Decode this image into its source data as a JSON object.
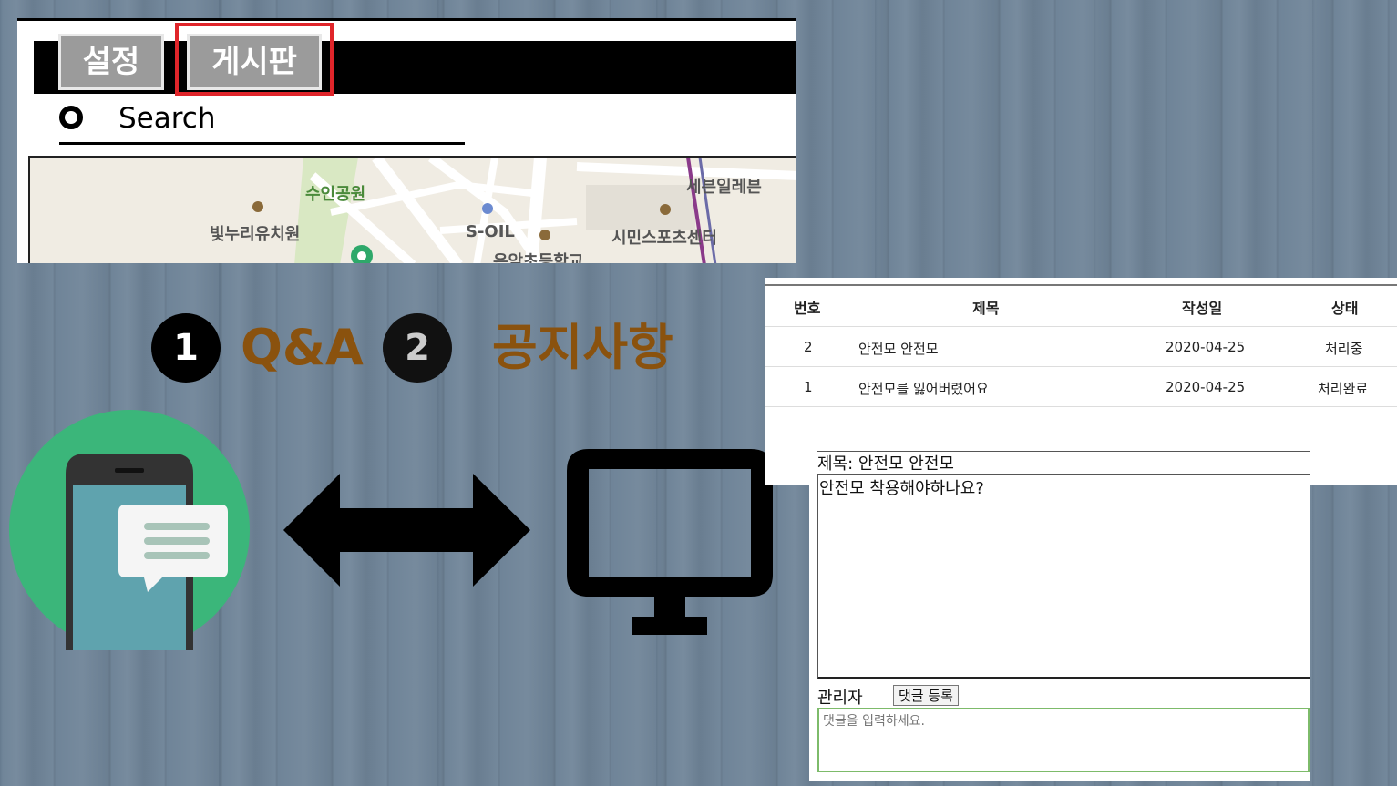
{
  "app": {
    "tabs": [
      {
        "label": "설정"
      },
      {
        "label": "게시판"
      }
    ],
    "search_label": "Search",
    "map_labels": [
      "수인공원",
      "빛누리유치원",
      "S-OIL",
      "시민스포츠센터",
      "세븐일레븐",
      "은암초등학교"
    ]
  },
  "steps": [
    {
      "number": "1",
      "label": "Q&A"
    },
    {
      "number": "2",
      "label": "공지사항"
    }
  ],
  "board": {
    "headers": [
      "번호",
      "제목",
      "작성일",
      "상태"
    ],
    "rows": [
      {
        "no": "2",
        "title": "안전모 안전모",
        "date": "2020-04-25",
        "status": "처리중"
      },
      {
        "no": "1",
        "title": "안전모를 잃어버렸어요",
        "date": "2020-04-25",
        "status": "처리완료"
      }
    ]
  },
  "detail": {
    "title": "제목: 안전모 안전모",
    "body": "안전모 착용해야하나요?",
    "author_label": "관리자",
    "submit_label": "댓글 등록",
    "comment_placeholder": "댓글을 입력하세요."
  },
  "colors": {
    "highlight": "#e0252a",
    "label_text": "#8a520e",
    "icon_green": "#3bb67a",
    "phone_screen": "#5fa3ae"
  },
  "icons": [
    "mobile-chat-icon",
    "double-arrow-icon",
    "monitor-icon",
    "search-circle-icon"
  ]
}
